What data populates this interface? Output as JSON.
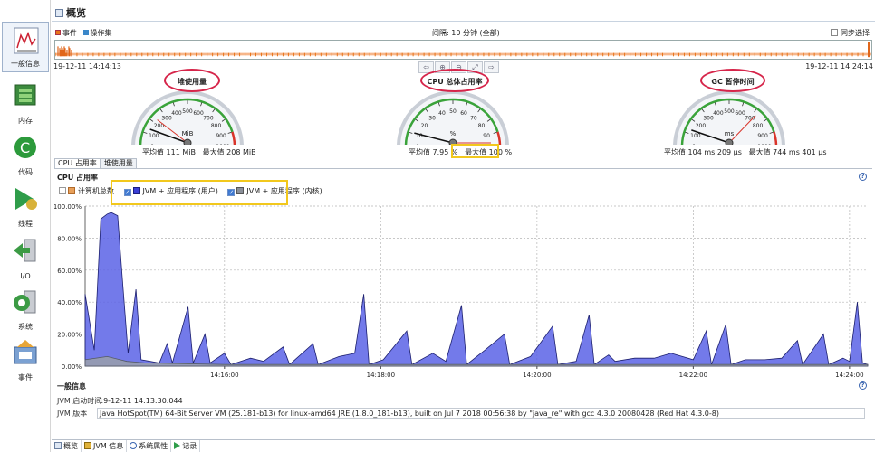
{
  "sidebar": {
    "items": [
      {
        "label": "一般信息",
        "icon": "overview-chart-icon",
        "active": true
      },
      {
        "label": "内存",
        "icon": "memory-icon"
      },
      {
        "label": "代码",
        "icon": "code-icon"
      },
      {
        "label": "线程",
        "icon": "threads-icon"
      },
      {
        "label": "I/O",
        "icon": "io-icon"
      },
      {
        "label": "系统",
        "icon": "system-icon"
      },
      {
        "label": "事件",
        "icon": "events-icon"
      }
    ]
  },
  "header": {
    "title": "概览"
  },
  "timeline": {
    "legend_events": "事件",
    "legend_ops": "操作集",
    "interval": "间隔: 10 分钟 (全部)",
    "sync_label": "同步选择",
    "start_time": "19-12-11 14:14:13",
    "end_time": "19-12-11 14:24:14",
    "colors": {
      "events": "#e8741a",
      "ops": "#3a87c9"
    }
  },
  "nav_buttons": [
    "⇦",
    "⊕",
    "⊖",
    "⤢",
    "⇨"
  ],
  "gauges": [
    {
      "title": "堆使用量",
      "unit": "MiB",
      "min": 0,
      "max": 1000,
      "value": 111,
      "max_value": 208,
      "ticks": [
        "0",
        "100",
        "200",
        "300",
        "400",
        "500",
        "600",
        "700",
        "800",
        "900",
        "1000"
      ],
      "stats_avg": "平均值 111 MiB",
      "stats_max": "最大值 208 MiB"
    },
    {
      "title": "CPU 总体占用率",
      "unit": "%",
      "min": 0,
      "max": 100,
      "value": 7.95,
      "max_value": 100,
      "ticks": [
        "0",
        "10",
        "20",
        "30",
        "40",
        "50",
        "60",
        "70",
        "80",
        "90",
        "100"
      ],
      "stats_avg": "平均值 7.95 %",
      "stats_max": "最大值 100 %"
    },
    {
      "title": "GC 暂停时间",
      "unit": "ms",
      "min": 0,
      "max": 1000,
      "value": 104,
      "max_value": 744,
      "ticks": [
        "0",
        "100",
        "200",
        "300",
        "400",
        "500",
        "600",
        "700",
        "800",
        "900",
        "1000"
      ],
      "stats_avg": "平均值 104 ms 209 μs",
      "stats_max": "最大值 744 ms 401 μs"
    }
  ],
  "subtabs": [
    "CPU 占用率",
    "堆使用量"
  ],
  "cpu_panel": {
    "title": "CPU 占用率",
    "help": "?",
    "legend": [
      {
        "label": "计算机总数",
        "checked": false,
        "color": "#e8a05a"
      },
      {
        "label": "JVM + 应用程序 (用户)",
        "checked": true,
        "color": "#3a3fd6"
      },
      {
        "label": "JVM + 应用程序 (内核)",
        "checked": true,
        "color": "#8a8f99"
      }
    ]
  },
  "chart_data": {
    "type": "area",
    "x_ticks": [
      "14:16:00",
      "14:18:00",
      "14:20:00",
      "14:22:00",
      "14:24:00"
    ],
    "y_ticks": [
      "0.00%",
      "20.00%",
      "40.00%",
      "60.00%",
      "80.00%",
      "100.00%"
    ],
    "ylim": [
      0,
      100
    ],
    "grid": true,
    "xlim": [
      "14:14:13",
      "14:24:14"
    ],
    "series": [
      {
        "name": "JVM + 应用程序 (用户)",
        "color": "#3a3fd6",
        "points": [
          [
            "14:14:13",
            45
          ],
          [
            "14:14:20",
            10
          ],
          [
            "14:14:25",
            92
          ],
          [
            "14:14:30",
            95
          ],
          [
            "14:14:33",
            96
          ],
          [
            "14:14:38",
            94
          ],
          [
            "14:14:42",
            50
          ],
          [
            "14:14:46",
            8
          ],
          [
            "14:14:52",
            48
          ],
          [
            "14:14:56",
            4
          ],
          [
            "14:15:03",
            3
          ],
          [
            "14:15:10",
            2
          ],
          [
            "14:15:16",
            14
          ],
          [
            "14:15:20",
            2
          ],
          [
            "14:15:32",
            37
          ],
          [
            "14:15:36",
            2
          ],
          [
            "14:15:45",
            20
          ],
          [
            "14:15:49",
            2
          ],
          [
            "14:16:00",
            8
          ],
          [
            "14:16:05",
            1
          ],
          [
            "14:16:20",
            5
          ],
          [
            "14:16:30",
            3
          ],
          [
            "14:16:45",
            12
          ],
          [
            "14:16:50",
            1
          ],
          [
            "14:17:08",
            14
          ],
          [
            "14:17:12",
            1
          ],
          [
            "14:17:28",
            6
          ],
          [
            "14:17:40",
            8
          ],
          [
            "14:17:47",
            45
          ],
          [
            "14:17:51",
            1
          ],
          [
            "14:18:02",
            4
          ],
          [
            "14:18:20",
            22
          ],
          [
            "14:18:24",
            1
          ],
          [
            "14:18:40",
            8
          ],
          [
            "14:18:50",
            3
          ],
          [
            "14:19:02",
            38
          ],
          [
            "14:19:06",
            1
          ],
          [
            "14:19:20",
            10
          ],
          [
            "14:19:35",
            20
          ],
          [
            "14:19:39",
            1
          ],
          [
            "14:19:55",
            6
          ],
          [
            "14:20:12",
            25
          ],
          [
            "14:20:16",
            1
          ],
          [
            "14:20:30",
            3
          ],
          [
            "14:20:40",
            32
          ],
          [
            "14:20:44",
            1
          ],
          [
            "14:20:55",
            7
          ],
          [
            "14:21:00",
            3
          ],
          [
            "14:21:15",
            5
          ],
          [
            "14:21:30",
            5
          ],
          [
            "14:21:43",
            8
          ],
          [
            "14:22:00",
            4
          ],
          [
            "14:22:10",
            22
          ],
          [
            "14:22:14",
            1
          ],
          [
            "14:22:25",
            26
          ],
          [
            "14:22:29",
            1
          ],
          [
            "14:22:40",
            4
          ],
          [
            "14:22:55",
            4
          ],
          [
            "14:23:08",
            5
          ],
          [
            "14:23:20",
            16
          ],
          [
            "14:23:24",
            1
          ],
          [
            "14:23:40",
            20
          ],
          [
            "14:23:44",
            1
          ],
          [
            "14:23:55",
            5
          ],
          [
            "14:24:00",
            3
          ],
          [
            "14:24:06",
            40
          ],
          [
            "14:24:10",
            2
          ],
          [
            "14:24:14",
            1
          ]
        ]
      },
      {
        "name": "JVM + 应用程序 (内核)",
        "color": "#8a8f99",
        "points": [
          [
            "14:14:13",
            4
          ],
          [
            "14:14:30",
            6
          ],
          [
            "14:14:45",
            3
          ],
          [
            "14:15:00",
            2
          ],
          [
            "14:16:00",
            1
          ],
          [
            "14:18:00",
            1
          ],
          [
            "14:20:00",
            1
          ],
          [
            "14:22:00",
            1
          ],
          [
            "14:24:14",
            1
          ]
        ]
      }
    ]
  },
  "general": {
    "title": "一般信息",
    "help": "?",
    "rows": [
      {
        "key": "JVM 启动时间",
        "value": "19-12-11 14:13:30.044"
      },
      {
        "key": "JVM 版本",
        "value": "Java HotSpot(TM) 64-Bit Server VM (25.181-b13) for linux-amd64 JRE (1.8.0_181-b13), built on Jul  7 2018 00:56:38 by \"java_re\" with gcc 4.3.0 20080428 (Red Hat 4.3.0-8)"
      }
    ]
  },
  "bottom_tabs": [
    {
      "label": "概览",
      "icon": "overview-tab-icon"
    },
    {
      "label": "JVM 信息",
      "icon": "jvm-info-icon"
    },
    {
      "label": "系统属性",
      "icon": "system-props-icon"
    },
    {
      "label": "记录",
      "icon": "record-icon"
    }
  ]
}
